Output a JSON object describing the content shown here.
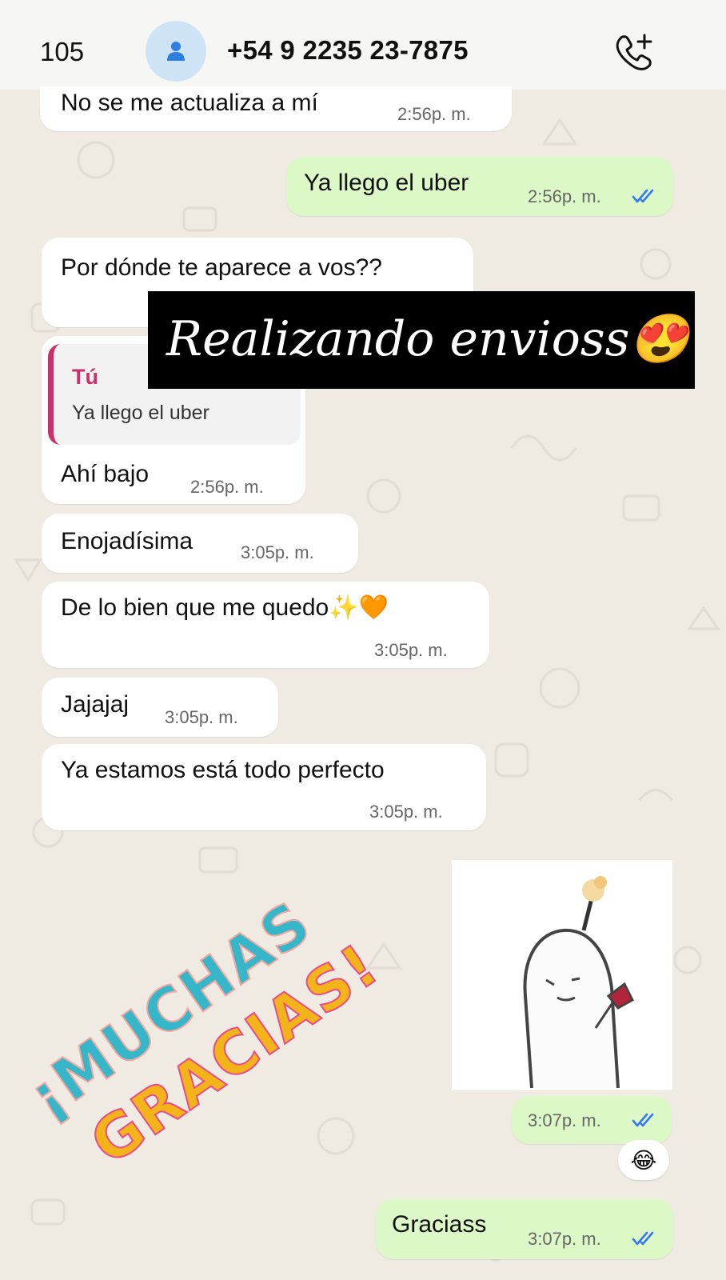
{
  "header": {
    "back_count": "105",
    "contact_name": "+54 9 2235 23-7875"
  },
  "messages": [
    {
      "side": "in",
      "text": "No se me actualiza a mí",
      "time": "2:56p. m."
    },
    {
      "side": "out",
      "text": "Ya llego el uber",
      "time": "2:56p. m.",
      "read": true
    },
    {
      "side": "in",
      "text": "Por dónde te aparece a vos??"
    },
    {
      "side": "in",
      "text": "Ahí bajo",
      "time": "2:56p. m.",
      "quote": {
        "author": "Tú",
        "text": "Ya llego el uber"
      }
    },
    {
      "side": "in",
      "text": "Enojadísima",
      "time": "3:05p. m."
    },
    {
      "side": "in",
      "text": "De lo bien que me quedo✨🧡",
      "time": "3:05p. m."
    },
    {
      "side": "in",
      "text": "Jajajaj",
      "time": "3:05p. m."
    },
    {
      "side": "in",
      "text": "Ya estamos está todo perfecto",
      "time": "3:05p. m."
    },
    {
      "side": "out",
      "type": "sticker",
      "time": "3:07p. m.",
      "read": true,
      "reaction": "😂"
    },
    {
      "side": "out",
      "text": "Graciass",
      "time": "3:07p. m.",
      "read": true
    }
  ],
  "overlays": {
    "story_caption": "Realizando envioss😍",
    "sticker_text_line1": "¡MUCHAS",
    "sticker_text_line2": "GRACIAS!"
  },
  "colors": {
    "chat_background": "#efeae2",
    "incoming_bubble": "#ffffff",
    "outgoing_bubble": "#dcf8c6",
    "read_ticks": "#3478f6",
    "quote_accent": "#cc2f6c",
    "avatar_bg": "#cfe3f7"
  },
  "icons": [
    "back-chevron-icon",
    "person-icon",
    "add-call-icon",
    "read-ticks-icon"
  ]
}
